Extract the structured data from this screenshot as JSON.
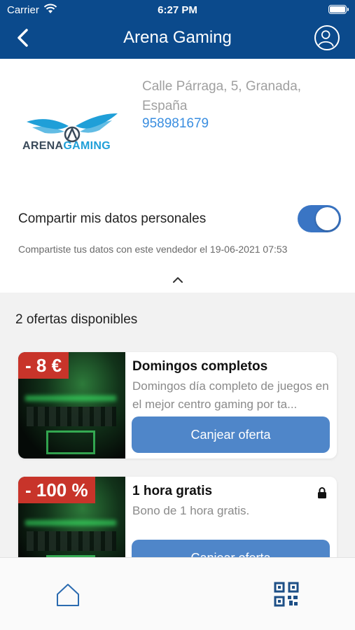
{
  "status_bar": {
    "carrier": "Carrier",
    "time": "6:27 PM"
  },
  "nav": {
    "title": "Arena Gaming"
  },
  "seller": {
    "logo_text_primary": "ARENA",
    "logo_text_secondary": "GAMING",
    "address": "Calle Párraga, 5, Granada, España",
    "phone": "958981679",
    "share_label": "Compartir mis datos personales",
    "share_enabled": true,
    "share_note": "Compartiste tus datos con este vendedor el 19-06-2021 07:53"
  },
  "offers_count": "2 ofertas disponibles",
  "offers": [
    {
      "discount": "- 8 €",
      "title": "Domingos completos",
      "description": "Domingos día completo de juegos en el mejor centro gaming por ta...",
      "button": "Canjear oferta",
      "locked": false
    },
    {
      "discount": "- 100 %",
      "title": "1 hora gratis",
      "description": "Bono de 1 hora gratis.",
      "button": "Canjear oferta",
      "locked": true
    }
  ],
  "icons": {
    "back": "chevron-left-icon",
    "profile": "user-icon",
    "collapse": "chevron-up-icon",
    "lock": "lock-icon",
    "home": "home-icon",
    "qr": "qr-code-icon"
  },
  "colors": {
    "nav_background": "#0b4a8c",
    "toggle_on": "#3a75c4",
    "button": "#4f86c9",
    "discount_badge": "#c8342a",
    "link": "#3a8ee0"
  }
}
